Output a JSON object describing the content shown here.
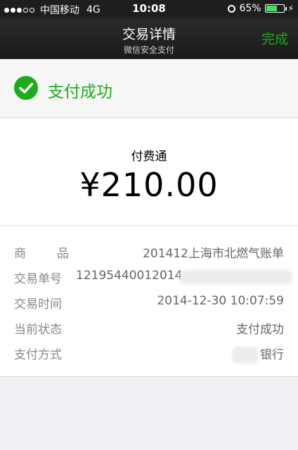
{
  "status_bar": {
    "carrier": "中国移动",
    "network": "4G",
    "time": "10:08",
    "battery_percent": "65%",
    "battery_level": 0.65
  },
  "nav": {
    "title": "交易详情",
    "subtitle": "微信安全支付",
    "done_label": "完成"
  },
  "result": {
    "status_text": "支付成功"
  },
  "payment": {
    "merchant": "付费通",
    "amount": "¥210.00"
  },
  "details": {
    "product_label": "商品",
    "product_value": "201412上海市北燃气账单",
    "order_label": "交易单号",
    "order_value": "12195440012014",
    "time_label": "交易时间",
    "time_value": "2014-12-30 10:07:59",
    "state_label": "当前状态",
    "state_value": "支付成功",
    "method_label": "支付方式",
    "method_value": "银行"
  },
  "colors": {
    "accent_green": "#1aad19",
    "nav_bg": "#1e1e1e",
    "page_bg": "#efeff4"
  }
}
